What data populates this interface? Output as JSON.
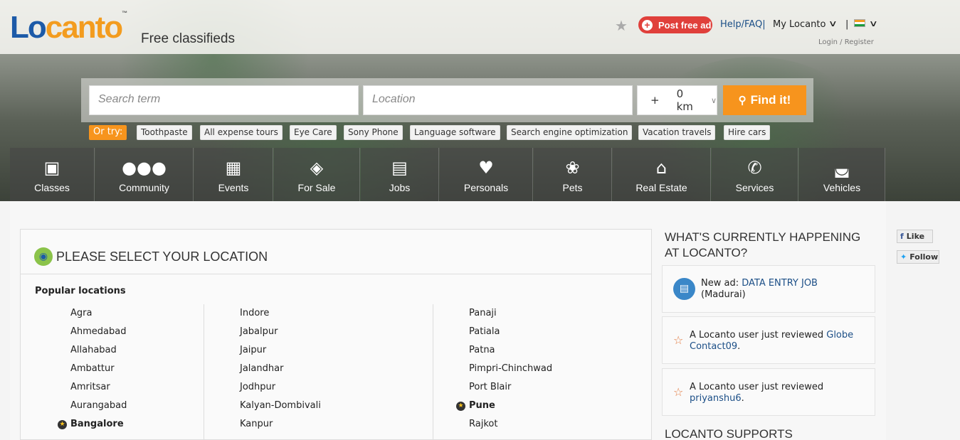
{
  "header": {
    "logo_lo": "Lo",
    "logo_canto": "canto",
    "logo_tm": "™",
    "tagline": "Free classifieds",
    "post_ad": "Post free ad",
    "help": "Help/FAQ|",
    "my_locanto": "My Locanto",
    "separator": "|",
    "login": "Login / Register"
  },
  "search": {
    "term_placeholder": "Search term",
    "location_placeholder": "Location",
    "radius_plus": "+",
    "radius_value": "0 km",
    "find_button": "Find it!",
    "or_try_label": "Or try:",
    "suggestions": [
      "Toothpaste",
      "All expense tours",
      "Eye Care",
      "Sony Phone",
      "Language software",
      "Search engine optimization",
      "Vacation travels",
      "Hire cars"
    ]
  },
  "categories": [
    {
      "label": "Classes",
      "icon": "teacher-board-icon"
    },
    {
      "label": "Community",
      "icon": "people-icon"
    },
    {
      "label": "Events",
      "icon": "calendar-icon"
    },
    {
      "label": "For Sale",
      "icon": "price-tag-icon"
    },
    {
      "label": "Jobs",
      "icon": "briefcase-icon"
    },
    {
      "label": "Personals",
      "icon": "heart-icon"
    },
    {
      "label": "Pets",
      "icon": "paw-icon"
    },
    {
      "label": "Real Estate",
      "icon": "house-icon"
    },
    {
      "label": "Services",
      "icon": "phone-icon"
    },
    {
      "label": "Vehicles",
      "icon": "car-icon"
    }
  ],
  "location": {
    "title": "PLEASE SELECT YOUR LOCATION",
    "popular_label": "Popular locations",
    "col1": [
      "Agra",
      "Ahmedabad",
      "Allahabad",
      "Ambattur",
      "Amritsar",
      "Aurangabad",
      "Bangalore"
    ],
    "col2": [
      "Indore",
      "Jabalpur",
      "Jaipur",
      "Jalandhar",
      "Jodhpur",
      "Kalyan-Dombivali",
      "Kanpur"
    ],
    "col3": [
      "Panaji",
      "Patiala",
      "Patna",
      "Pimpri-Chinchwad",
      "Port Blair",
      "Pune",
      "Rajkot"
    ],
    "starred": [
      "Bangalore",
      "Pune"
    ]
  },
  "sidebar": {
    "happening_title_1": "WHAT'S CURRENTLY HAPPENING",
    "happening_title_2": "AT LOCANTO?",
    "feed": [
      {
        "prefix": "New ad: ",
        "link": "DATA ENTRY JOB",
        "suffix": "(Madurai)"
      },
      {
        "prefix": "A Locanto user just reviewed ",
        "link": "Globe Contact09",
        "suffix": "."
      },
      {
        "prefix": "A Locanto user just reviewed ",
        "link": "priyanshu6",
        "suffix": "."
      }
    ],
    "supports_title": "LOCANTO SUPPORTS"
  },
  "social": {
    "like": "Like",
    "follow": "Follow"
  },
  "colors": {
    "brand_blue": "#1c5aa8",
    "brand_orange": "#f39c1f",
    "post_ad_red": "#e0403b",
    "find_orange": "#f7941d"
  }
}
